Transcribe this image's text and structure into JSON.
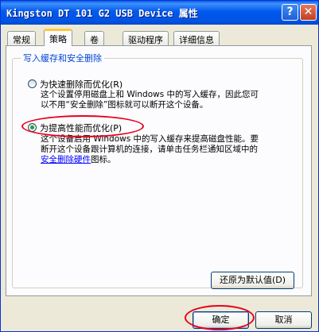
{
  "window": {
    "title": "Kingston DT 101 G2 USB Device 属性",
    "help_label": "?",
    "close_label": "✕"
  },
  "tabs": [
    {
      "label": "常规"
    },
    {
      "label": "策略"
    },
    {
      "label": "卷"
    },
    {
      "label": "驱动程序"
    },
    {
      "label": "详细信息"
    }
  ],
  "group": {
    "title": "写入缓存和安全删除"
  },
  "option_quick": {
    "label": "为快速删除而优化(R)",
    "line1": "这个设置停用磁盘上和 Windows 中的写入缓存，因此您可",
    "line2": "以不用“安全删除”图标就可以断开这个设备。"
  },
  "option_perf": {
    "label": "为提高性能而优化(P)",
    "line1": "这个设备启用 Windows 中的写入缓存来提高磁盘性能。要",
    "line2": "断开这个设备跟计算机的连接，请单击任务栏通知区域中的",
    "link": "安全删除硬件",
    "line3_suffix": "图标。"
  },
  "buttons": {
    "restore_defaults": "还原为默认值(D)",
    "ok": "确定",
    "cancel": "取消"
  }
}
